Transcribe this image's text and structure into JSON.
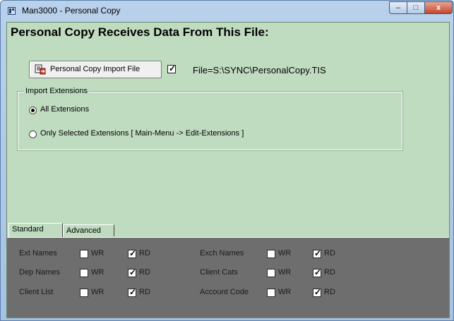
{
  "window": {
    "title": "Man3000  - Personal Copy",
    "buttons": {
      "minimize": "–",
      "maximize": "□",
      "close": "x"
    }
  },
  "heading": "Personal Copy Receives Data From This File:",
  "import_button": {
    "label": "Personal Copy Import File",
    "icon": "import-file-icon"
  },
  "file_checkbox": {
    "checked": true
  },
  "file_label": "File=S:\\SYNC\\PersonalCopy.TIS",
  "import_extensions": {
    "legend": "Import Extensions",
    "options": [
      {
        "label": "All Extensions",
        "selected": true
      },
      {
        "label": "Only Selected Extensions [ Main-Menu -> Edit-Extensions ]",
        "selected": false
      }
    ]
  },
  "tabs": [
    {
      "label": "Standard",
      "active": true
    },
    {
      "label": "Advanced",
      "active": false
    }
  ],
  "permissions": {
    "wr_label": "WR",
    "rd_label": "RD",
    "rows": [
      {
        "left": {
          "name": "Ext Names",
          "wr": false,
          "rd": true
        },
        "right": {
          "name": "Exch Names",
          "wr": false,
          "rd": true
        }
      },
      {
        "left": {
          "name": "Dep Names",
          "wr": false,
          "rd": true
        },
        "right": {
          "name": "Client Cats",
          "wr": false,
          "rd": true
        }
      },
      {
        "left": {
          "name": "Client List",
          "wr": false,
          "rd": true
        },
        "right": {
          "name": "Account Code",
          "wr": false,
          "rd": true
        }
      }
    ]
  },
  "colors": {
    "client_bg": "#c0dcc0",
    "panel_bg": "#6e6e6e",
    "titlebar": "#a6c2e2"
  }
}
